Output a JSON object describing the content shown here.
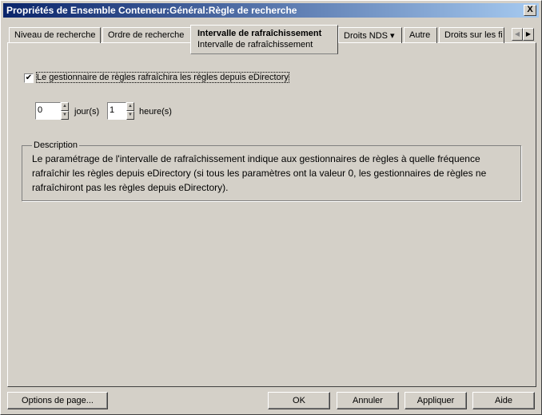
{
  "window": {
    "title": "Propriétés de Ensemble Conteneur:Général:Règle de recherche",
    "close": "X"
  },
  "tabs": [
    {
      "label": "Niveau de recherche"
    },
    {
      "label": "Ordre de recherche"
    },
    {
      "label": "Intervalle de rafraîchissement",
      "sub": "Intervalle de rafraîchissement"
    },
    {
      "label": "Droits NDS ▾"
    },
    {
      "label": "Autre"
    },
    {
      "label": "Droits sur les fi"
    }
  ],
  "content": {
    "checkbox_label": "Le gestionnaire de règles rafraîchira les règles depuis eDirectory",
    "checked": true,
    "days_value": "0",
    "days_label": "jour(s)",
    "hours_value": "1",
    "hours_label": "heure(s)",
    "description_title": "Description",
    "description": "Le paramétrage de l'intervalle de rafraîchissement indique aux gestionnaires de règles à quelle fréquence rafraîchir les règles depuis eDirectory (si tous les paramètres ont la valeur 0, les gestionnaires de règles ne rafraîchiront pas les règles depuis eDirectory)."
  },
  "buttons": {
    "page_options": "Options de page...",
    "ok": "OK",
    "cancel": "Annuler",
    "apply": "Appliquer",
    "help": "Aide"
  }
}
